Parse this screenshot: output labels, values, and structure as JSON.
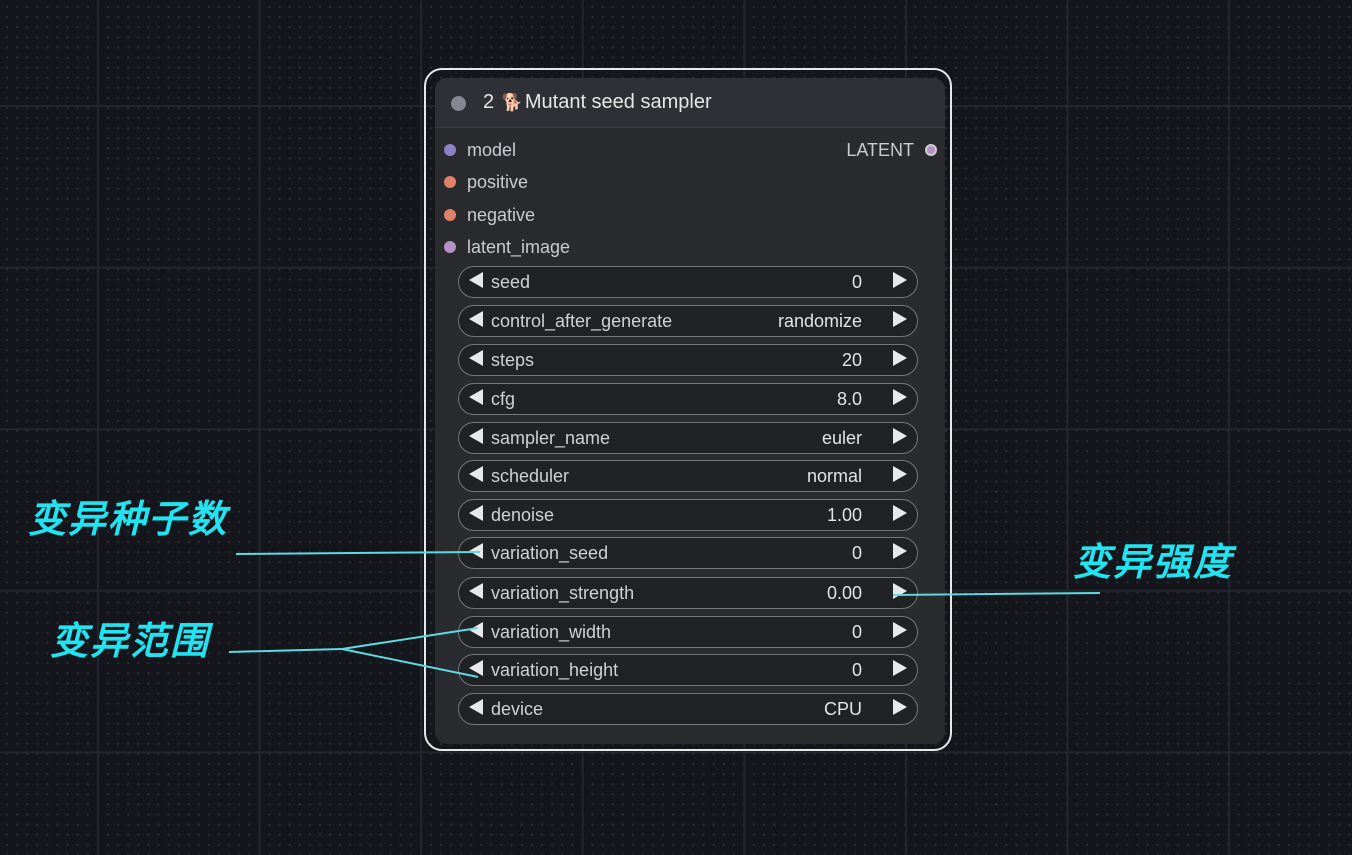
{
  "node": {
    "id": "2",
    "icon": "dog-icon",
    "title": "Mutant seed sampler",
    "inputs": [
      {
        "label": "model",
        "color": "#8f7fc4"
      },
      {
        "label": "positive",
        "color": "#e0826a"
      },
      {
        "label": "negative",
        "color": "#e0826a"
      },
      {
        "label": "latent_image",
        "color": "#b591c4"
      }
    ],
    "outputs": [
      {
        "label": "LATENT",
        "color": "#b591c4"
      }
    ],
    "widgets": [
      {
        "label": "seed",
        "value": "0"
      },
      {
        "label": "control_after_generate",
        "value": "randomize"
      },
      {
        "label": "steps",
        "value": "20"
      },
      {
        "label": "cfg",
        "value": "8.0"
      },
      {
        "label": "sampler_name",
        "value": "euler"
      },
      {
        "label": "scheduler",
        "value": "normal"
      },
      {
        "label": "denoise",
        "value": "1.00"
      },
      {
        "label": "variation_seed",
        "value": "0"
      },
      {
        "label": "variation_strength",
        "value": "0.00"
      },
      {
        "label": "variation_width",
        "value": "0"
      },
      {
        "label": "variation_height",
        "value": "0"
      },
      {
        "label": "device",
        "value": "CPU"
      }
    ]
  },
  "annotations": {
    "variation_seed": "变异种子数",
    "variation_range": "变异范围",
    "variation_strength": "变异强度",
    "color": "#21e4f0"
  }
}
